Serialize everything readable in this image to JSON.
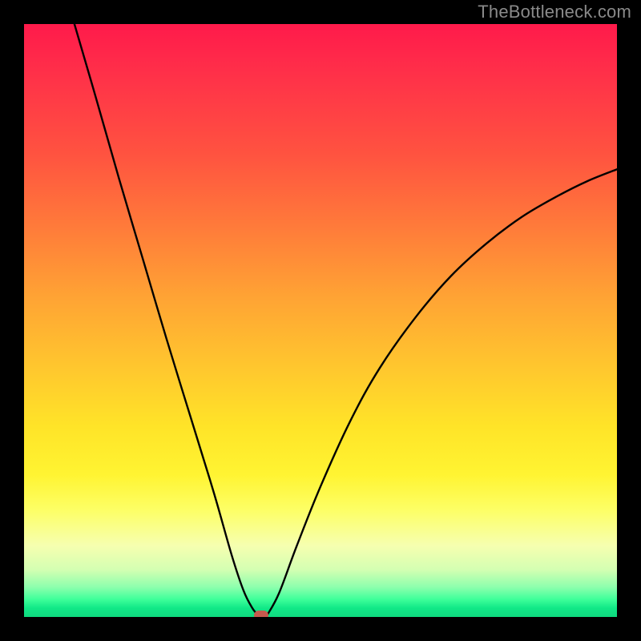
{
  "watermark": "TheBottleneck.com",
  "chart_data": {
    "type": "line",
    "title": "",
    "xlabel": "",
    "ylabel": "",
    "xlim": [
      0,
      100
    ],
    "ylim": [
      0,
      100
    ],
    "grid": false,
    "series": [
      {
        "name": "left-branch",
        "x": [
          8.5,
          12,
          16,
          20,
          24,
          28,
          32,
          35,
          37,
          38.5,
          39.5
        ],
        "y": [
          100,
          88,
          74,
          60.5,
          47,
          34,
          21,
          10.5,
          4.5,
          1.5,
          0.3
        ]
      },
      {
        "name": "right-branch",
        "x": [
          41,
          43,
          46,
          50,
          55,
          60,
          66,
          72,
          78,
          84,
          90,
          95,
          100
        ],
        "y": [
          0.3,
          4,
          12,
          22,
          33,
          42,
          50.5,
          57.5,
          63,
          67.5,
          71,
          73.5,
          75.5
        ]
      }
    ],
    "marker": {
      "x": 40,
      "y": 0.3,
      "color": "#c65a4e"
    },
    "gradient_bottom_to_top": [
      "green",
      "yellow",
      "orange",
      "red"
    ]
  }
}
